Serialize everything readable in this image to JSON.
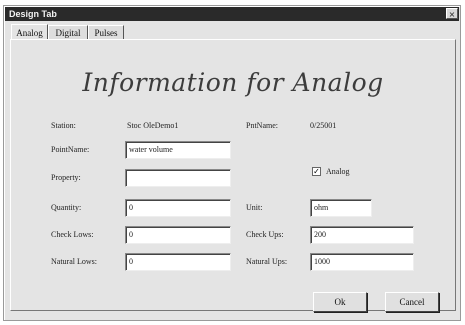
{
  "window": {
    "title": "Design Tab",
    "close_glyph": "×"
  },
  "tabs": [
    {
      "label": "Analog",
      "active": true
    },
    {
      "label": "Digital",
      "active": false
    },
    {
      "label": "Pulses",
      "active": false
    }
  ],
  "heading": "Information for Analog",
  "form": {
    "station_label": "Station:",
    "station_value": "Stoc OleDemo1",
    "pointname_top_label": "PntName:",
    "pointname_top_value": "0/25001",
    "pointname_label": "PointName:",
    "pointname_value": "water volume",
    "property_label": "Property:",
    "property_value": "",
    "analog_check_label": "Analog",
    "analog_checked": true,
    "quantity_label": "Quantity:",
    "quantity_value": "0",
    "unit_label": "Unit:",
    "unit_value": "ohm",
    "check_lows_label": "Check Lows:",
    "check_lows_value": "0",
    "check_ups_label": "Check Ups:",
    "check_ups_value": "200",
    "normal_lows_label": "Natural Lows:",
    "normal_lows_value": "0",
    "normal_ups_label": "Natural Ups:",
    "normal_ups_value": "1000"
  },
  "buttons": {
    "ok_label": "Ok",
    "cancel_label": "Cancel"
  }
}
